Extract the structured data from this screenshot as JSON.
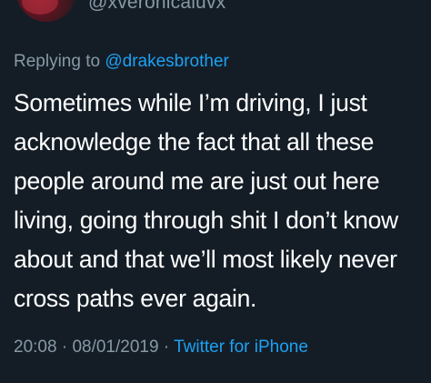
{
  "tweet": {
    "handle": "@xveronicaluvx",
    "reply_prefix": "Replying to ",
    "reply_mention": "@drakesbrother",
    "text": "Sometimes while I’m driving, I just\nacknowledge the fact that all these\npeople around me are just out here\nliving, going through shit I don’t know\nabout and that we’ll most likely never\ncross paths ever again.",
    "time": "20:08",
    "separator": " · ",
    "date": "08/01/2019",
    "source": "Twitter for iPhone"
  },
  "colors": {
    "background": "#141d26",
    "secondary_text": "#8899a6",
    "link": "#1da1f2",
    "primary_text": "#ffffff"
  }
}
